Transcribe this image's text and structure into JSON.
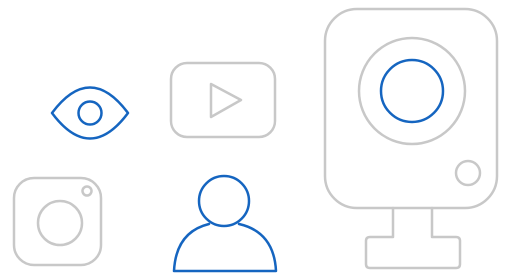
{
  "icons": [
    {
      "name": "eye-icon",
      "color": "#1565c0"
    },
    {
      "name": "video-play-icon",
      "color": "#c8c8c8"
    },
    {
      "name": "security-camera-icon",
      "color": "#c8c8c8",
      "lens_color": "#1565c0"
    },
    {
      "name": "instagram-icon",
      "color": "#c8c8c8"
    },
    {
      "name": "user-icon",
      "color": "#1565c0"
    }
  ],
  "colors": {
    "background": "#ffffff",
    "gray_stroke": "#c8c8c8",
    "blue_stroke": "#1565c0"
  }
}
